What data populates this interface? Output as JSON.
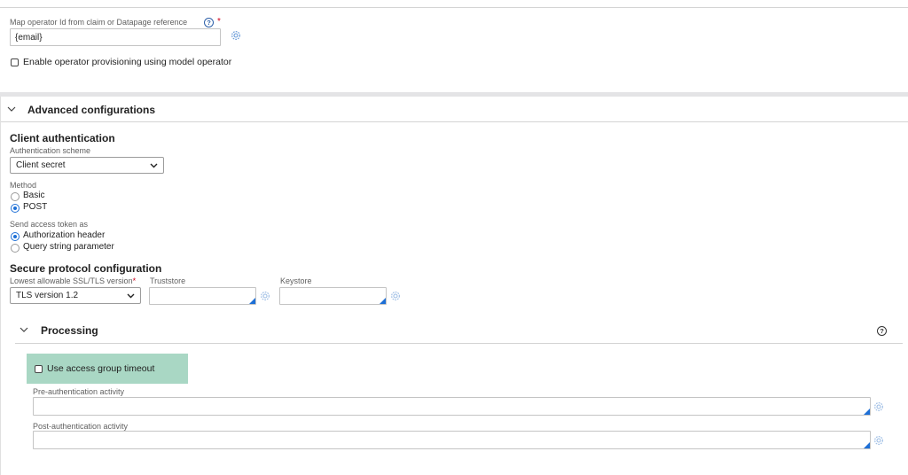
{
  "top_section": {
    "map_operator_label": "Map operator Id from claim or Datapage reference",
    "required_star": "*",
    "map_operator_value": "{email}",
    "enable_provisioning_label": "Enable operator provisioning using model operator"
  },
  "advanced": {
    "title": "Advanced configurations",
    "client_auth": {
      "heading": "Client authentication",
      "scheme_label": "Authentication scheme",
      "scheme_value": "Client secret",
      "method_label": "Method",
      "method_options": [
        "Basic",
        "POST"
      ],
      "method_selected": "POST",
      "send_token_label": "Send access token as",
      "send_token_options": [
        "Authorization header",
        "Query string parameter"
      ],
      "send_token_selected": "Authorization header"
    },
    "secure_protocol": {
      "heading": "Secure protocol configuration",
      "ssl_label": "Lowest allowable SSL/TLS version",
      "ssl_required": "*",
      "ssl_value": "TLS version 1.2",
      "truststore_label": "Truststore",
      "keystore_label": "Keystore"
    }
  },
  "processing": {
    "title": "Processing",
    "use_access_group_timeout_label": "Use access group timeout",
    "pre_auth_label": "Pre-authentication activity",
    "post_auth_label": "Post-authentication activity"
  },
  "colors": {
    "highlight": "#a9d7c4",
    "accent": "#1d6fd6",
    "required": "#d0021b"
  },
  "icons": [
    "help-icon",
    "gear-icon",
    "chevron-down-icon",
    "select-arrow-icon"
  ]
}
